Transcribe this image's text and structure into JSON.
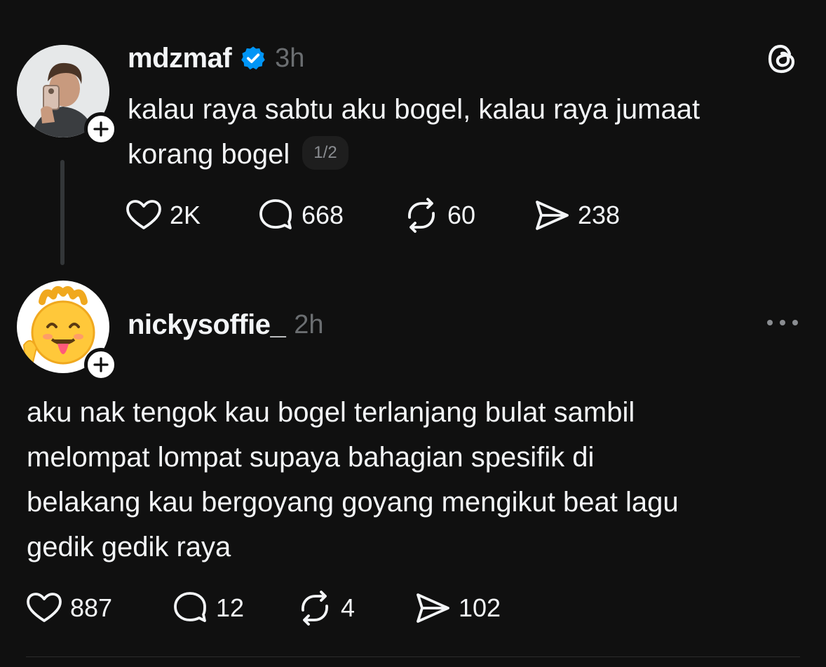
{
  "posts": [
    {
      "username": "mdzmaf",
      "verified": true,
      "time": "3h",
      "text_lines": [
        "kalau raya sabtu aku bogel, kalau raya jumaat",
        "korang bogel"
      ],
      "pager": "1/2",
      "stats": {
        "likes": "2K",
        "replies": "668",
        "reposts": "60",
        "shares": "238"
      }
    },
    {
      "username": "nickysoffie_",
      "time": "2h",
      "text_lines": [
        "aku nak tengok kau bogel terlanjang bulat sambil",
        "melompat lompat supaya bahagian spesifik di",
        "belakang kau bergoyang goyang mengikut beat lagu",
        "gedik gedik raya"
      ],
      "stats": {
        "likes": "887",
        "replies": "12",
        "reposts": "4",
        "shares": "102"
      }
    }
  ],
  "icons": {
    "app_logo": "threads-logo-icon",
    "more": "more-horizontal-icon",
    "like": "heart-icon",
    "reply": "comment-bubble-icon",
    "repost": "repost-icon",
    "share": "send-icon",
    "verified": "verified-badge-icon",
    "follow": "plus-icon"
  },
  "colors": {
    "background": "#101010",
    "text": "#f3f5f7",
    "muted": "#6b6e71",
    "verified": "#0095f6"
  }
}
